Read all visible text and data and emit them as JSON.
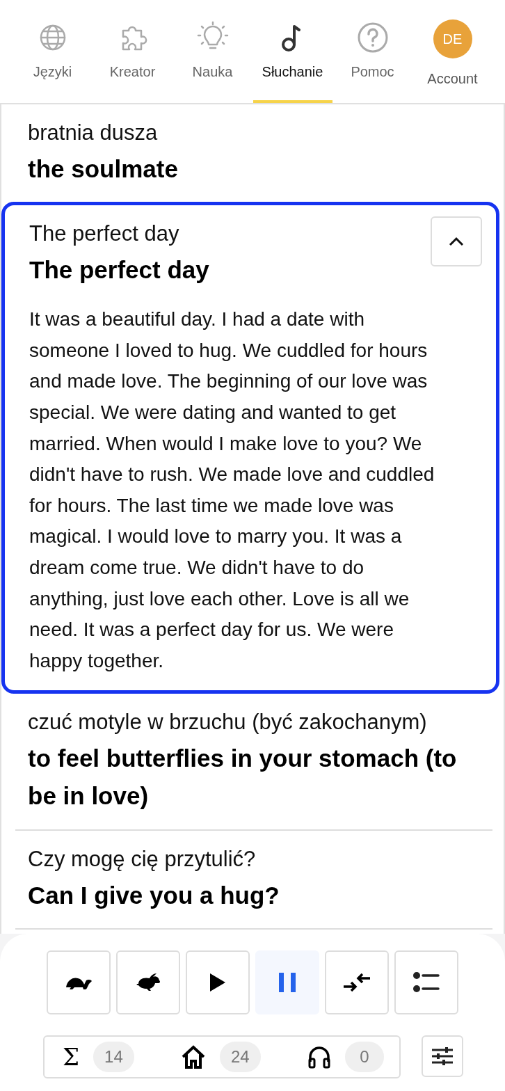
{
  "nav": [
    {
      "label": "Języki",
      "selected": false
    },
    {
      "label": "Kreator",
      "selected": false
    },
    {
      "label": "Nauka",
      "selected": false
    },
    {
      "label": "Słuchanie",
      "selected": true
    },
    {
      "label": "Pomoc",
      "selected": false
    }
  ],
  "account": {
    "initials": "DE",
    "label": "Account"
  },
  "items": [
    {
      "source": "bratnia dusza",
      "translation": "the soulmate",
      "expanded": false
    },
    {
      "source": "The perfect day",
      "translation": "The perfect day",
      "expanded": true,
      "story": "It was a beautiful day. I had a date with someone I loved to hug. We cuddled for hours and made love. The beginning of our love was special. We were dating and wanted to get married. When would I make love to you? We didn't have to rush. We made love and cuddled for hours. The last time we made love was magical. I would love to marry you. It was a dream come true. We didn't have to do anything, just love each other. Love is all we need. It was a perfect day for us. We were happy together."
    },
    {
      "source": "czuć motyle w brzuchu (być zakochanym)",
      "translation": "to feel butterflies in your stomach (to be in love)",
      "expanded": false
    },
    {
      "source": "Czy mogę cię przytulić?",
      "translation": "Can I give you a hug?",
      "expanded": false
    }
  ],
  "player": {
    "buttons": [
      {
        "kind": "turtle",
        "selected": false
      },
      {
        "kind": "rabbit",
        "selected": false
      },
      {
        "kind": "play",
        "selected": false
      },
      {
        "kind": "pause",
        "selected": true
      },
      {
        "kind": "shuffle",
        "selected": false
      },
      {
        "kind": "list",
        "selected": false
      }
    ],
    "stats": [
      {
        "kind": "sigma",
        "symbol": "Σ",
        "count": "14"
      },
      {
        "kind": "home",
        "count": "24"
      },
      {
        "kind": "headphones",
        "count": "0"
      }
    ]
  }
}
